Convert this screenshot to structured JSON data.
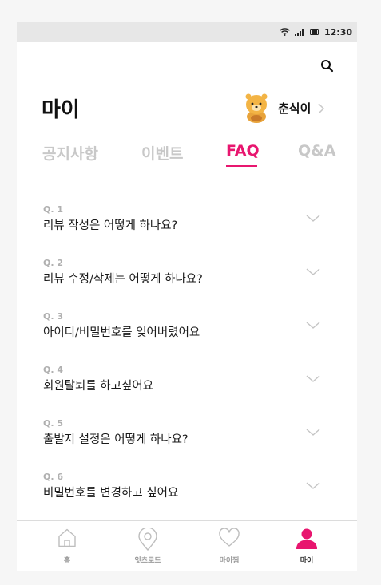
{
  "status_bar": {
    "time": "12:30",
    "icons": [
      "wifi-icon",
      "signal-icon",
      "battery-icon"
    ]
  },
  "header": {
    "title": "마이",
    "search_icon": "search-icon"
  },
  "profile": {
    "name": "춘식이",
    "avatar_icon": "character-avatar-icon"
  },
  "tabs": [
    {
      "label": "공지사항",
      "active": false
    },
    {
      "label": "이벤트",
      "active": false
    },
    {
      "label": "FAQ",
      "active": true
    },
    {
      "label": "Q&A",
      "active": false
    }
  ],
  "faq": [
    {
      "number": "Q. 1",
      "title": "리뷰 작성은 어떻게 하나요?"
    },
    {
      "number": "Q. 2",
      "title": "리뷰 수정/삭제는 어떻게 하나요?"
    },
    {
      "number": "Q. 3",
      "title": "아이디/비밀번호를 잊어버렸어요"
    },
    {
      "number": "Q. 4",
      "title": "회원탈퇴를 하고싶어요"
    },
    {
      "number": "Q. 5",
      "title": "출발지 설정은 어떻게 하나요?"
    },
    {
      "number": "Q. 6",
      "title": "비밀번호를 변경하고 싶어요"
    }
  ],
  "bottom_nav": [
    {
      "label": "홈",
      "icon": "home-icon",
      "active": false
    },
    {
      "label": "잇츠로드",
      "icon": "location-pin-icon",
      "active": false
    },
    {
      "label": "마이찜",
      "icon": "heart-icon",
      "active": false
    },
    {
      "label": "마이",
      "icon": "person-icon",
      "active": true
    }
  ],
  "colors": {
    "accent": "#e8166f",
    "inactive_tab": "#c8c8c8",
    "divider": "#dcdcdc"
  }
}
